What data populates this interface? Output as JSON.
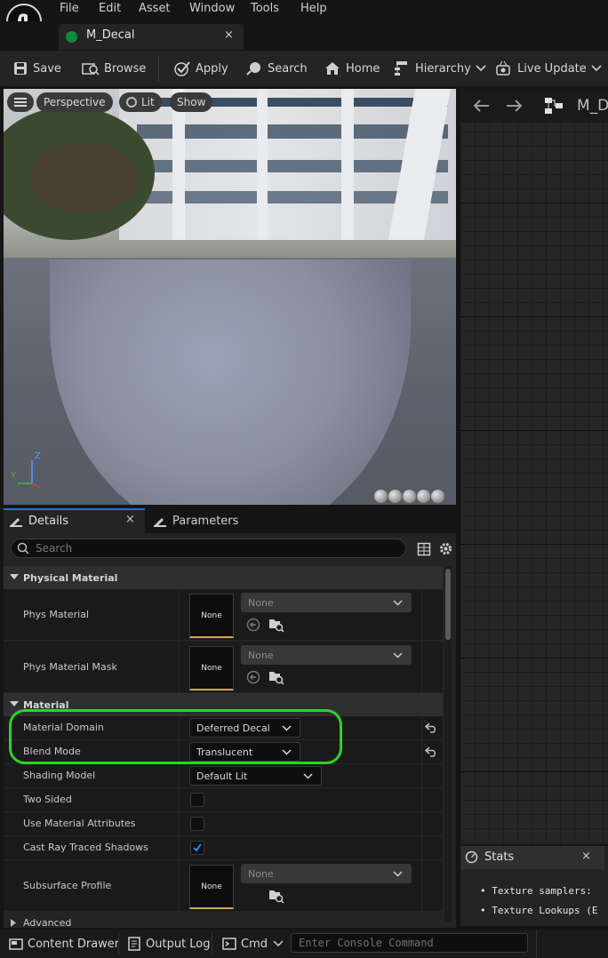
{
  "menu": [
    "File",
    "Edit",
    "Asset",
    "Window",
    "Tools",
    "Help"
  ],
  "doc_tab": {
    "label": "M_Decal",
    "close": "×"
  },
  "toolbar": {
    "save": "Save",
    "browse": "Browse",
    "apply": "Apply",
    "search": "Search",
    "home": "Home",
    "hierarchy": "Hierarchy",
    "live_update": "Live Update"
  },
  "viewport": {
    "mode": "Perspective",
    "lighting": "Lit",
    "show": "Show",
    "axis_z": "Z",
    "axis_y": "Y"
  },
  "graph": {
    "title": "M_D"
  },
  "details": {
    "tab_details": "Details",
    "tab_close": "×",
    "tab_parameters": "Parameters",
    "search_placeholder": "Search",
    "cat_physical": "Physical Material",
    "phys_material": "Phys Material",
    "phys_material_mask": "Phys Material Mask",
    "none_thumb": "None",
    "none_combo": "None",
    "cat_material": "Material",
    "material_domain": "Material Domain",
    "material_domain_value": "Deferred Decal",
    "blend_mode": "Blend Mode",
    "blend_mode_value": "Translucent",
    "shading_model": "Shading Model",
    "shading_model_value": "Default Lit",
    "two_sided": "Two Sided",
    "use_material_attributes": "Use Material Attributes",
    "cast_ray_traced_shadows": "Cast Ray Traced Shadows",
    "subsurface_profile": "Subsurface Profile",
    "cat_advanced": "Advanced",
    "cast_ray_traced_checked": true
  },
  "stats": {
    "title": "Stats",
    "close": "×",
    "lines": [
      "Texture samplers:",
      "Texture Lookups (E"
    ]
  },
  "statusbar": {
    "content_drawer": "Content Drawer",
    "output_log": "Output Log",
    "cmd": "Cmd",
    "console_placeholder": "Enter Console Command"
  },
  "colors": {
    "accent_green": "#29d528",
    "thumb_underline": "#d5a64a",
    "check_blue": "#1f6fe0"
  }
}
